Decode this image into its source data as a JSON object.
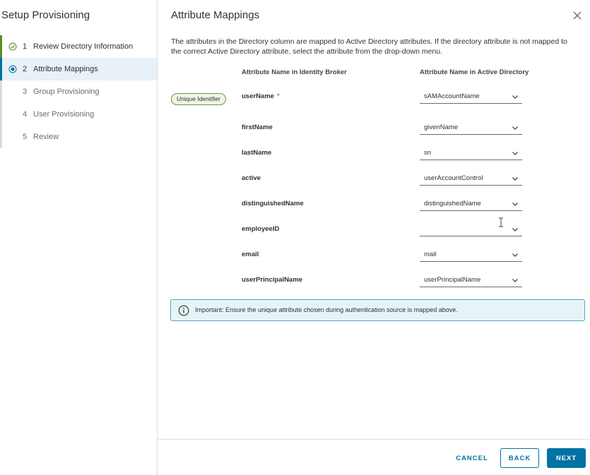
{
  "wizard": {
    "title": "Setup Provisioning",
    "steps": [
      {
        "num": "1",
        "label": "Review Directory Information",
        "state": "done"
      },
      {
        "num": "2",
        "label": "Attribute Mappings",
        "state": "current"
      },
      {
        "num": "3",
        "label": "Group Provisioning",
        "state": "pending"
      },
      {
        "num": "4",
        "label": "User Provisioning",
        "state": "pending"
      },
      {
        "num": "5",
        "label": "Review",
        "state": "pending"
      }
    ]
  },
  "main": {
    "title": "Attribute Mappings",
    "description": "The attributes in the Directory column are mapped to Active Directory attributes. If the directory attribute is not mapped to the correct Active Directory attribute, select the attribute from the drop-down menu.",
    "col_left": "Attribute Name in Identity Broker",
    "col_right": "Attribute Name in Active Directory",
    "unique_badge": "Unique Identifier",
    "required_marker": "*",
    "mappings": [
      {
        "attr": "userName",
        "value": "sAMAccountName"
      },
      {
        "attr": "firstName",
        "value": "givenName"
      },
      {
        "attr": "lastName",
        "value": "sn"
      },
      {
        "attr": "active",
        "value": "userAccountControl"
      },
      {
        "attr": "distinguishedName",
        "value": "distinguishedName"
      },
      {
        "attr": "employeeID",
        "value": ""
      },
      {
        "attr": "email",
        "value": "mail"
      },
      {
        "attr": "userPrincipalName",
        "value": "userPrincipalName"
      }
    ],
    "alert": "Important: Ensure the unique attribute chosen during authentication source is mapped above."
  },
  "footer": {
    "cancel": "CANCEL",
    "back": "BACK",
    "next": "NEXT"
  },
  "colors": {
    "accent": "#0072a3",
    "done": "#5d8a2f",
    "required": "#c92100"
  }
}
